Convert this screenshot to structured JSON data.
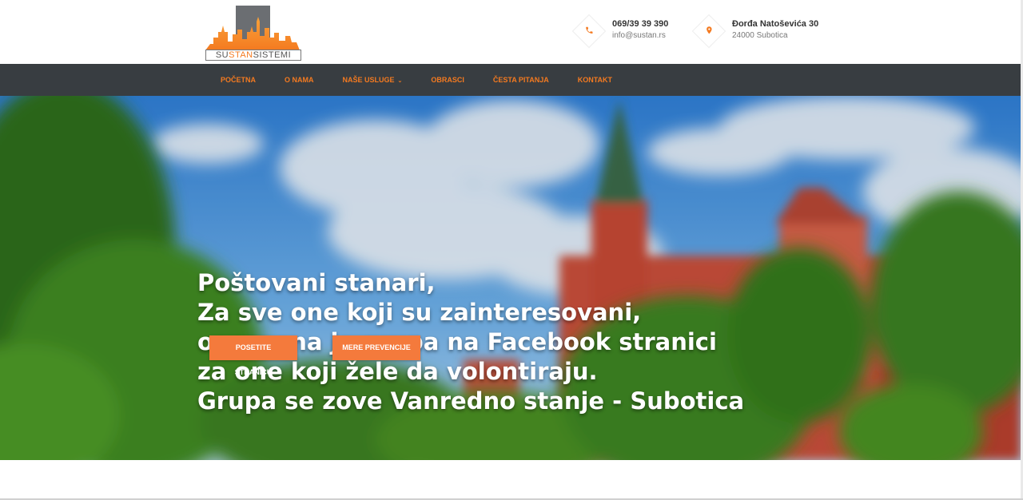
{
  "logo": {
    "text_left": "SU",
    "text_accent": "STAN",
    "text_right": "SISTEMI",
    "colors": {
      "accent": "#f47a20",
      "dark": "#555555"
    }
  },
  "contact": {
    "phone": {
      "icon": "phone-icon",
      "line1": "069/39 39 390",
      "line2": "info@sustan.rs"
    },
    "address": {
      "icon": "map-pin-icon",
      "line1": "Đorđa Natoševića 30",
      "line2": "24000 Subotica"
    }
  },
  "nav": {
    "items": [
      {
        "label": "POČETNA"
      },
      {
        "label": "O NAMA"
      },
      {
        "label": "NAŠE USLUGE",
        "has_dropdown": true
      },
      {
        "label": "OBRASCI"
      },
      {
        "label": "ČESTA PITANJA"
      },
      {
        "label": "KONTAKT"
      }
    ],
    "colors": {
      "background": "#383d41",
      "text": "#f47a20"
    }
  },
  "hero": {
    "lines": [
      "Poštovani stanari,",
      "Za sve one koji su zainteresovani,",
      "osnovana je grupa na Facebook stranici",
      "za one koji žele da volontiraju.",
      "Grupa se zove Vanredno stanje - Subotica"
    ],
    "buttons": [
      {
        "label": "POSETITE STRANICU"
      },
      {
        "label": "MERE PREVENCIJE"
      }
    ],
    "colors": {
      "button": "#f47a3c"
    }
  }
}
